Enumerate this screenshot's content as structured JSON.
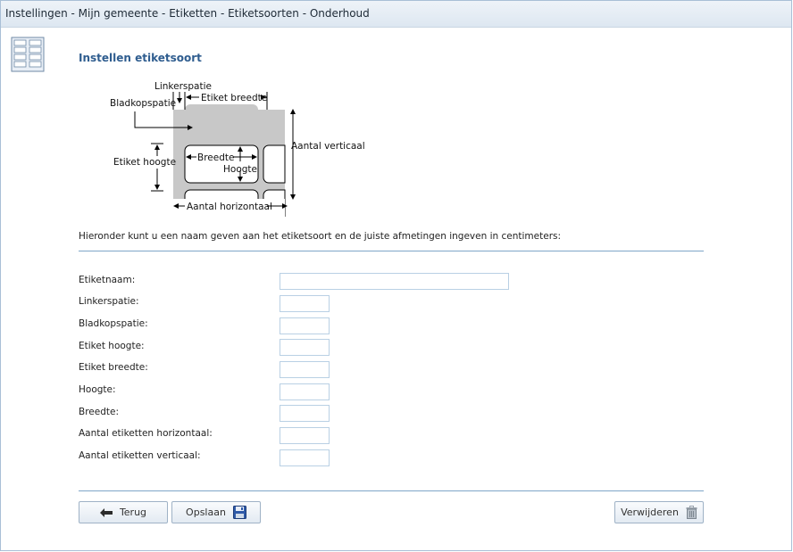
{
  "window": {
    "title": "Instellingen - Mijn gemeente - Etiketten - Etiketsoorten - Onderhoud"
  },
  "page": {
    "icon": "label-sheet-icon",
    "title": "Instellen etiketsoort",
    "intro": "Hieronder kunt u een naam geven aan het etiketsoort en de juiste afmetingen ingeven in centimeters:"
  },
  "diagram": {
    "linkerspatie": "Linkerspatie",
    "etiket_breedte": "Etiket breedte",
    "bladkopspatie": "Bladkopspatie",
    "aantal_verticaal": "Aantal verticaal",
    "etiket_hoogte": "Etiket hoogte",
    "breedte": "Breedte",
    "hoogte": "Hoogte",
    "aantal_horizontaal": "Aantal horizontaal"
  },
  "form": {
    "fields": [
      {
        "label": "Etiketnaam:",
        "value": "",
        "placeholder": ""
      },
      {
        "label": "Linkerspatie:",
        "value": "",
        "placeholder": ""
      },
      {
        "label": "Bladkopspatie:",
        "value": "",
        "placeholder": ""
      },
      {
        "label": "Etiket hoogte:",
        "value": "",
        "placeholder": ""
      },
      {
        "label": "Etiket breedte:",
        "value": "",
        "placeholder": ""
      },
      {
        "label": "Hoogte:",
        "value": "",
        "placeholder": ""
      },
      {
        "label": "Breedte:",
        "value": "",
        "placeholder": ""
      },
      {
        "label": "Aantal etiketten horizontaal:",
        "value": "",
        "placeholder": ""
      },
      {
        "label": "Aantal etiketten verticaal:",
        "value": "",
        "placeholder": ""
      }
    ]
  },
  "buttons": {
    "back": {
      "label": "Terug",
      "icon": "arrow-left-icon"
    },
    "save": {
      "label": "Opslaan",
      "icon": "floppy-disk-icon"
    },
    "delete": {
      "label": "Verwijderen",
      "icon": "trash-icon"
    }
  },
  "colors": {
    "title_blue": "#2f5d8f",
    "rule_blue": "#7fa6c8",
    "input_border": "#b9d0e4",
    "sheet_gray": "#c8c8c8"
  }
}
